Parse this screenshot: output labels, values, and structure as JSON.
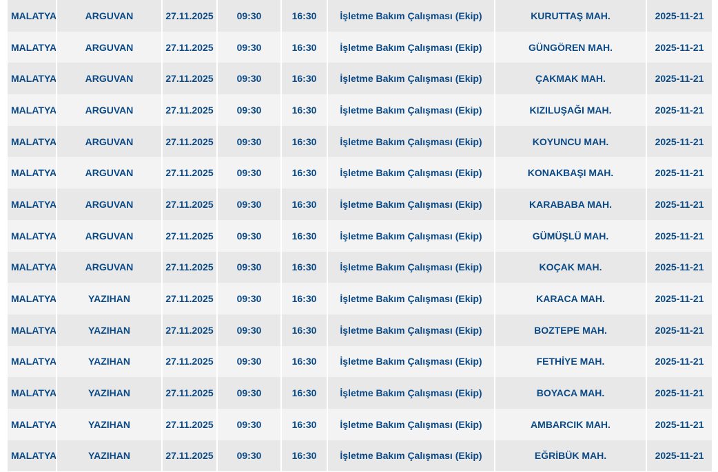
{
  "table": {
    "rows": [
      [
        "MALATYA",
        "ARGUVAN",
        "27.11.2025",
        "09:30",
        "16:30",
        "İşletme Bakım Çalışması (Ekip)",
        "KURUTTAŞ MAH.",
        "2025-11-21"
      ],
      [
        "MALATYA",
        "ARGUVAN",
        "27.11.2025",
        "09:30",
        "16:30",
        "İşletme Bakım Çalışması (Ekip)",
        "GÜNGÖREN MAH.",
        "2025-11-21"
      ],
      [
        "MALATYA",
        "ARGUVAN",
        "27.11.2025",
        "09:30",
        "16:30",
        "İşletme Bakım Çalışması (Ekip)",
        "ÇAKMAK MAH.",
        "2025-11-21"
      ],
      [
        "MALATYA",
        "ARGUVAN",
        "27.11.2025",
        "09:30",
        "16:30",
        "İşletme Bakım Çalışması (Ekip)",
        "KIZILUŞAĞI MAH.",
        "2025-11-21"
      ],
      [
        "MALATYA",
        "ARGUVAN",
        "27.11.2025",
        "09:30",
        "16:30",
        "İşletme Bakım Çalışması (Ekip)",
        "KOYUNCU MAH.",
        "2025-11-21"
      ],
      [
        "MALATYA",
        "ARGUVAN",
        "27.11.2025",
        "09:30",
        "16:30",
        "İşletme Bakım Çalışması (Ekip)",
        "KONAKBAŞI MAH.",
        "2025-11-21"
      ],
      [
        "MALATYA",
        "ARGUVAN",
        "27.11.2025",
        "09:30",
        "16:30",
        "İşletme Bakım Çalışması (Ekip)",
        "KARABABA MAH.",
        "2025-11-21"
      ],
      [
        "MALATYA",
        "ARGUVAN",
        "27.11.2025",
        "09:30",
        "16:30",
        "İşletme Bakım Çalışması (Ekip)",
        "GÜMÜŞLÜ MAH.",
        "2025-11-21"
      ],
      [
        "MALATYA",
        "ARGUVAN",
        "27.11.2025",
        "09:30",
        "16:30",
        "İşletme Bakım Çalışması (Ekip)",
        "KOÇAK MAH.",
        "2025-11-21"
      ],
      [
        "MALATYA",
        "YAZIHAN",
        "27.11.2025",
        "09:30",
        "16:30",
        "İşletme Bakım Çalışması (Ekip)",
        "KARACA MAH.",
        "2025-11-21"
      ],
      [
        "MALATYA",
        "YAZIHAN",
        "27.11.2025",
        "09:30",
        "16:30",
        "İşletme Bakım Çalışması (Ekip)",
        "BOZTEPE MAH.",
        "2025-11-21"
      ],
      [
        "MALATYA",
        "YAZIHAN",
        "27.11.2025",
        "09:30",
        "16:30",
        "İşletme Bakım Çalışması (Ekip)",
        "FETHİYE MAH.",
        "2025-11-21"
      ],
      [
        "MALATYA",
        "YAZIHAN",
        "27.11.2025",
        "09:30",
        "16:30",
        "İşletme Bakım Çalışması (Ekip)",
        "BOYACA MAH.",
        "2025-11-21"
      ],
      [
        "MALATYA",
        "YAZIHAN",
        "27.11.2025",
        "09:30",
        "16:30",
        "İşletme Bakım Çalışması (Ekip)",
        "AMBARCIK MAH.",
        "2025-11-21"
      ],
      [
        "MALATYA",
        "YAZIHAN",
        "27.11.2025",
        "09:30",
        "16:30",
        "İşletme Bakım Çalışması (Ekip)",
        "EĞRİBÜK MAH.",
        "2025-11-21"
      ]
    ]
  },
  "colors": {
    "text": "#0b4a86",
    "row_dark": "#e8e8e8",
    "row_light": "#f3f3f3"
  }
}
